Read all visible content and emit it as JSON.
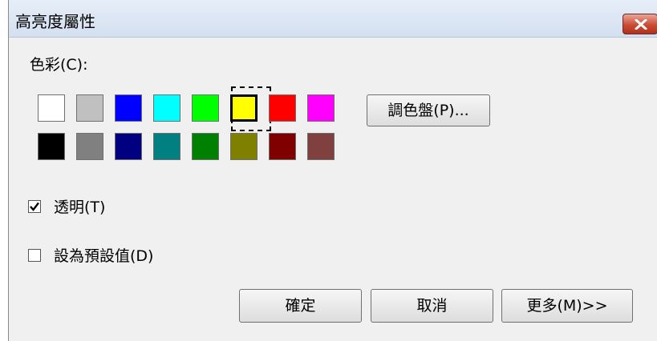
{
  "window": {
    "title": "高亮度屬性"
  },
  "color_section": {
    "label": "色彩(C):"
  },
  "swatches": [
    {
      "color": "#ffffff",
      "selected": false
    },
    {
      "color": "#c0c0c0",
      "selected": false
    },
    {
      "color": "#0000ff",
      "selected": false
    },
    {
      "color": "#00ffff",
      "selected": false
    },
    {
      "color": "#00ff00",
      "selected": false
    },
    {
      "color": "#ffff00",
      "selected": true
    },
    {
      "color": "#ff0000",
      "selected": false
    },
    {
      "color": "#ff00ff",
      "selected": false
    },
    {
      "color": "#000000",
      "selected": false
    },
    {
      "color": "#808080",
      "selected": false
    },
    {
      "color": "#000080",
      "selected": false
    },
    {
      "color": "#008080",
      "selected": false
    },
    {
      "color": "#008000",
      "selected": false
    },
    {
      "color": "#808000",
      "selected": false
    },
    {
      "color": "#800000",
      "selected": false
    },
    {
      "color": "#804040",
      "selected": false
    }
  ],
  "palette_button": {
    "label": "調色盤(P)..."
  },
  "transparent": {
    "label": "透明(T)",
    "checked": true
  },
  "set_default": {
    "label": "設為預設值(D)",
    "checked": false
  },
  "buttons": {
    "ok": "確定",
    "cancel": "取消",
    "more": "更多(M)>>"
  }
}
